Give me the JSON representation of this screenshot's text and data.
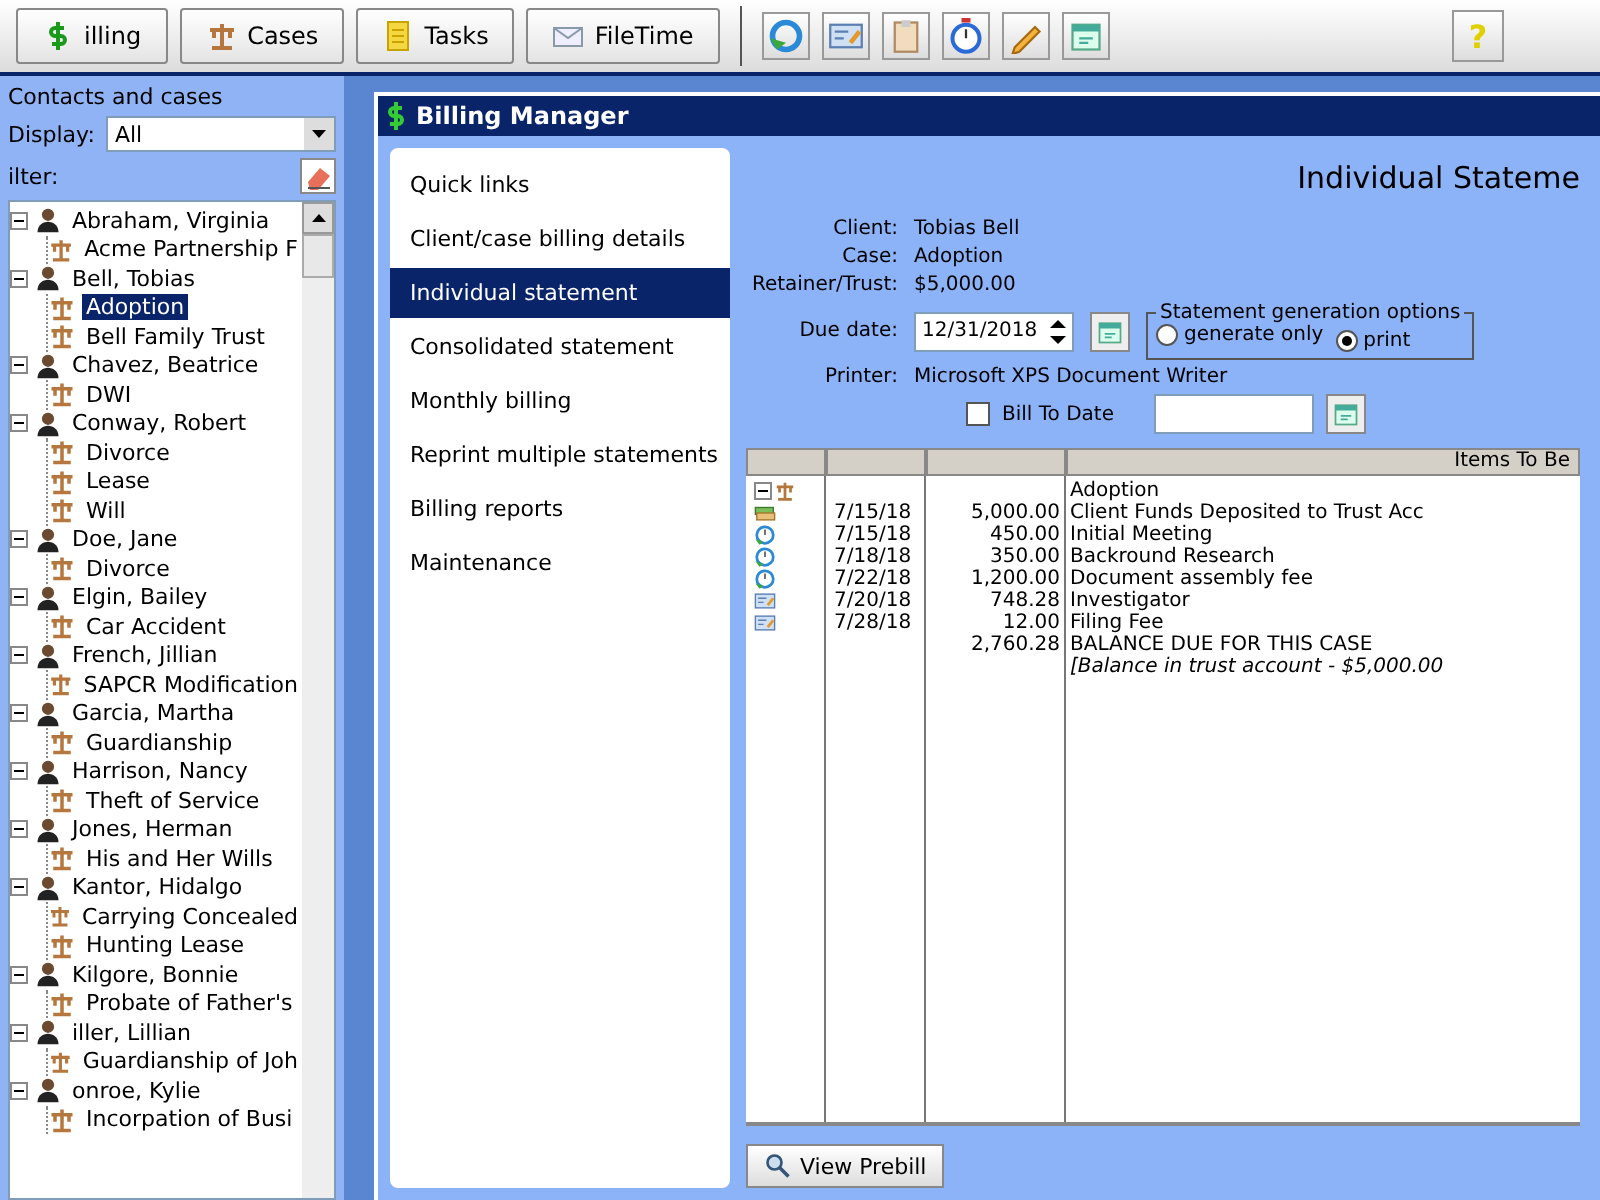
{
  "toolbar": {
    "buttons": [
      {
        "label": "illing",
        "kind": "billing"
      },
      {
        "label": "Cases",
        "kind": "cases"
      },
      {
        "label": "Tasks",
        "kind": "tasks"
      },
      {
        "label": "FileTime",
        "kind": "filetime"
      }
    ],
    "tools": [
      {
        "kind": "refresh"
      },
      {
        "kind": "card"
      },
      {
        "kind": "clipboard"
      },
      {
        "kind": "stopwatch"
      },
      {
        "kind": "pencil"
      },
      {
        "kind": "calendar"
      }
    ],
    "help": "?"
  },
  "contacts_panel": {
    "title": "Contacts and cases",
    "display_label": "Display:",
    "display_value": "All",
    "filter_label": "ilter:",
    "tree": [
      {
        "label": "Abraham, Virginia",
        "kind": "contact",
        "expanded": true,
        "selected": false,
        "children": [
          {
            "label": "Acme Partnership F",
            "kind": "case",
            "selected": false
          }
        ]
      },
      {
        "label": "Bell, Tobias",
        "kind": "contact",
        "expanded": true,
        "selected": false,
        "children": [
          {
            "label": "Adoption",
            "kind": "case",
            "selected": true
          },
          {
            "label": "Bell Family Trust",
            "kind": "case",
            "selected": false
          }
        ]
      },
      {
        "label": "Chavez, Beatrice",
        "kind": "contact",
        "expanded": true,
        "selected": false,
        "children": [
          {
            "label": "DWI",
            "kind": "case",
            "selected": false
          }
        ]
      },
      {
        "label": "Conway, Robert",
        "kind": "contact",
        "expanded": true,
        "selected": false,
        "children": [
          {
            "label": "Divorce",
            "kind": "case",
            "selected": false
          },
          {
            "label": "Lease",
            "kind": "case",
            "selected": false
          },
          {
            "label": "Will",
            "kind": "case",
            "selected": false
          }
        ]
      },
      {
        "label": "Doe, Jane",
        "kind": "contact",
        "expanded": true,
        "selected": false,
        "children": [
          {
            "label": "Divorce",
            "kind": "case",
            "selected": false
          }
        ]
      },
      {
        "label": "Elgin, Bailey",
        "kind": "contact",
        "expanded": true,
        "selected": false,
        "children": [
          {
            "label": "Car Accident",
            "kind": "case",
            "selected": false
          }
        ]
      },
      {
        "label": "French, Jillian",
        "kind": "contact",
        "expanded": true,
        "selected": false,
        "children": [
          {
            "label": "SAPCR Modification",
            "kind": "case",
            "selected": false
          }
        ]
      },
      {
        "label": "Garcia, Martha",
        "kind": "contact",
        "expanded": true,
        "selected": false,
        "children": [
          {
            "label": "Guardianship",
            "kind": "case",
            "selected": false
          }
        ]
      },
      {
        "label": "Harrison, Nancy",
        "kind": "contact",
        "expanded": true,
        "selected": false,
        "children": [
          {
            "label": "Theft of Service",
            "kind": "case",
            "selected": false
          }
        ]
      },
      {
        "label": "Jones, Herman",
        "kind": "contact",
        "expanded": true,
        "selected": false,
        "children": [
          {
            "label": "His and Her Wills",
            "kind": "case",
            "selected": false
          }
        ]
      },
      {
        "label": "Kantor, Hidalgo",
        "kind": "contact",
        "expanded": true,
        "selected": false,
        "children": [
          {
            "label": "Carrying Concealed",
            "kind": "case",
            "selected": false
          },
          {
            "label": "Hunting Lease",
            "kind": "case",
            "selected": false
          }
        ]
      },
      {
        "label": "Kilgore, Bonnie",
        "kind": "contact",
        "expanded": true,
        "selected": false,
        "children": [
          {
            "label": "Probate of Father's",
            "kind": "case",
            "selected": false
          }
        ]
      },
      {
        "label": "iller, Lillian",
        "kind": "contact",
        "expanded": true,
        "selected": false,
        "children": [
          {
            "label": "Guardianship of Joh",
            "kind": "case",
            "selected": false
          }
        ]
      },
      {
        "label": "onroe, Kylie",
        "kind": "contact",
        "expanded": true,
        "selected": false,
        "children": [
          {
            "label": "Incorpation of Busi",
            "kind": "case",
            "selected": false
          }
        ]
      }
    ]
  },
  "billing_window": {
    "title": "Billing Manager",
    "nav": [
      {
        "label": "Quick links",
        "selected": false
      },
      {
        "label": "Client/case billing details",
        "selected": false
      },
      {
        "label": "Individual statement",
        "selected": true
      },
      {
        "label": "Consolidated statement",
        "selected": false
      },
      {
        "label": "Monthly billing",
        "selected": false
      },
      {
        "label": "Reprint multiple statements",
        "selected": false
      },
      {
        "label": "Billing reports",
        "selected": false
      },
      {
        "label": "Maintenance",
        "selected": false
      }
    ],
    "statement": {
      "heading": "Individual Stateme",
      "fields": [
        {
          "label": "Client:",
          "value": "Tobias Bell"
        },
        {
          "label": "Case:",
          "value": "Adoption"
        },
        {
          "label": "Retainer/Trust:",
          "value": "$5,000.00"
        }
      ],
      "due_date": {
        "label": "Due date:",
        "value": "12/31/2018"
      },
      "printer": {
        "label": "Printer:",
        "value": "Microsoft XPS Document Writer"
      },
      "options": {
        "legend": "Statement generation options",
        "radios": [
          {
            "label": "generate only",
            "selected": false
          },
          {
            "label": "print",
            "selected": true
          }
        ]
      },
      "bill_to_date": {
        "label": "Bill To Date",
        "checked": false
      },
      "table": {
        "columns": [
          "",
          "",
          "",
          "Items To Be"
        ],
        "rows": [
          {
            "kind": "case",
            "date": "",
            "amount": "",
            "description": "Adoption"
          },
          {
            "kind": "deposit",
            "date": "7/15/18",
            "amount": "5,000.00",
            "description": "Client Funds Deposited to Trust Acc"
          },
          {
            "kind": "timer",
            "date": "7/15/18",
            "amount": "450.00",
            "description": "Initial Meeting"
          },
          {
            "kind": "timer",
            "date": "7/18/18",
            "amount": "350.00",
            "description": "Backround Research"
          },
          {
            "kind": "timer",
            "date": "7/22/18",
            "amount": "1,200.00",
            "description": "Document assembly fee"
          },
          {
            "kind": "expense",
            "date": "7/20/18",
            "amount": "748.28",
            "description": "Investigator"
          },
          {
            "kind": "expense",
            "date": "7/28/18",
            "amount": "12.00",
            "description": "Filing Fee"
          },
          {
            "kind": "total",
            "date": "",
            "amount": "2,760.28",
            "description": "BALANCE DUE FOR THIS CASE"
          },
          {
            "kind": "note",
            "date": "",
            "amount": "",
            "description": "[Balance in trust account - $5,000.00"
          }
        ]
      },
      "buttons": [
        {
          "label": "View Prebill",
          "kind": "search"
        }
      ]
    }
  }
}
